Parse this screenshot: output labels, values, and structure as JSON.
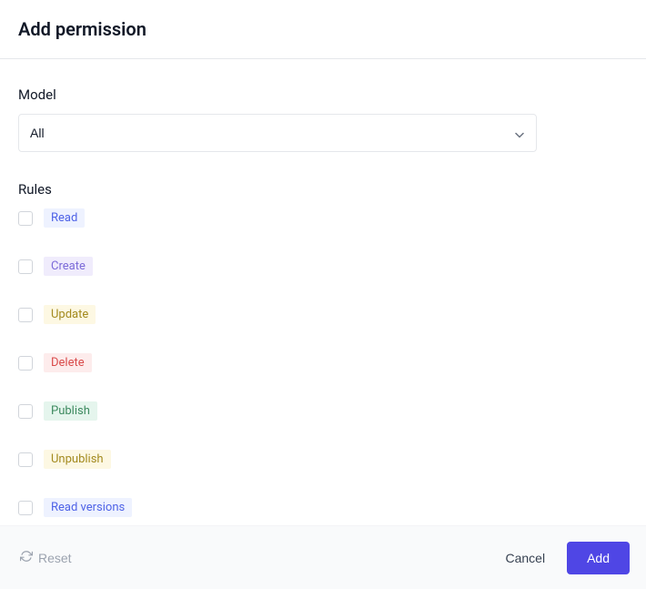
{
  "header": {
    "title": "Add permission"
  },
  "form": {
    "model_label": "Model",
    "model_value": "All",
    "rules_label": "Rules",
    "rules": [
      {
        "key": "read",
        "label": "Read",
        "checked": false,
        "tagClass": "tag-read"
      },
      {
        "key": "create",
        "label": "Create",
        "checked": false,
        "tagClass": "tag-create"
      },
      {
        "key": "update",
        "label": "Update",
        "checked": false,
        "tagClass": "tag-update"
      },
      {
        "key": "delete",
        "label": "Delete",
        "checked": false,
        "tagClass": "tag-delete"
      },
      {
        "key": "publish",
        "label": "Publish",
        "checked": false,
        "tagClass": "tag-publish"
      },
      {
        "key": "unpublish",
        "label": "Unpublish",
        "checked": false,
        "tagClass": "tag-unpublish"
      },
      {
        "key": "read_versions",
        "label": "Read versions",
        "checked": false,
        "tagClass": "tag-readversions"
      }
    ]
  },
  "footer": {
    "reset_label": "Reset",
    "cancel_label": "Cancel",
    "add_label": "Add"
  }
}
